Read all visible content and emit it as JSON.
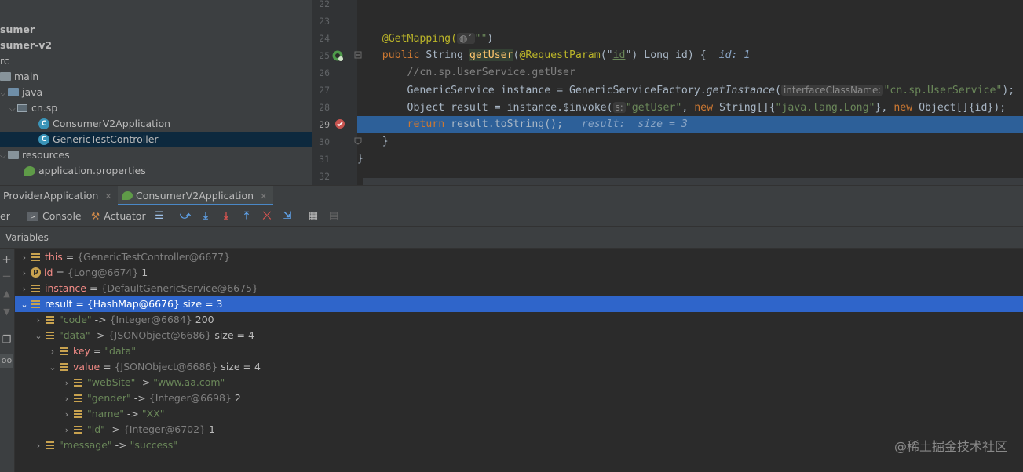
{
  "project_tree": [
    {
      "label": "sumer",
      "bold": true
    },
    {
      "label": "sumer-v2",
      "bold": true
    },
    {
      "label": "rc"
    },
    {
      "label": "main"
    },
    {
      "label": "java"
    },
    {
      "label": "cn.sp"
    },
    {
      "label": "ConsumerV2Application"
    },
    {
      "label": "GenericTestController"
    },
    {
      "label": "resources"
    },
    {
      "label": "application.properties"
    }
  ],
  "editor": {
    "line_numbers": [
      "22",
      "23",
      "24",
      "25",
      "26",
      "27",
      "28",
      "29",
      "30",
      "31",
      "32"
    ],
    "line24": {
      "annotation": "@GetMapping(",
      "icon_text": "◍˅",
      "str": "\"\"",
      "close": ")"
    },
    "line25": {
      "kw_public": "public",
      "type": " String ",
      "fn": "getUser",
      "open": "(",
      "ann": "@RequestParam",
      "p1": "(\"",
      "id": "id",
      "p2": "\") Long id) {",
      "hint": "id: 1"
    },
    "line26": {
      "comment": "//cn.sp.UserService.getUser"
    },
    "line27": {
      "pre": "GenericService instance = GenericServiceFactory.",
      "method": "getInstance",
      "open": "(",
      "hint": "interfaceClassName:",
      "str": "\"cn.sp.UserService\"",
      "close": ");"
    },
    "line28": {
      "pre": "Object result = instance.$invoke(",
      "hint": "s:",
      "str1": "\"getUser\"",
      "c1": ", ",
      "kw1": "new",
      "t1": " String[]{",
      "str2": "\"java.lang.Long\"",
      "c2": "}, ",
      "kw2": "new",
      "t2": " Object[]{id});"
    },
    "line29": {
      "kw": "return",
      "code": " result.toString();",
      "dbg": "result:  size = 3"
    },
    "line30": {
      "code": "}"
    },
    "line31": {
      "code": "}"
    }
  },
  "run_tabs": [
    {
      "label": "ProviderApplication",
      "active": false
    },
    {
      "label": "ConsumerV2Application",
      "active": true
    }
  ],
  "toolbar": {
    "debugger_label": "er",
    "console_label": "Console",
    "actuator_label": "Actuator"
  },
  "variables_header": "Variables",
  "variables": [
    {
      "name": "this",
      "eq": " = ",
      "value": "{GenericTestController@6677}"
    },
    {
      "name": "id",
      "eq": " = ",
      "value": "{Long@6674}",
      "extra": " 1"
    },
    {
      "name": "instance",
      "eq": " = ",
      "value": "{DefaultGenericService@6675}"
    },
    {
      "name": "result",
      "eq": " = ",
      "value": "{HashMap@6676}",
      "extra": "  size = 3"
    },
    {
      "key": "\"code\"",
      "arrow": " -> ",
      "value": "{Integer@6684}",
      "extra": " 200"
    },
    {
      "key": "\"data\"",
      "arrow": " -> ",
      "value": "{JSONObject@6686}",
      "extra": "  size = 4"
    },
    {
      "name": "key",
      "eq": " = ",
      "str": "\"data\""
    },
    {
      "name": "value",
      "eq": " = ",
      "value": "{JSONObject@6686}",
      "extra": "  size = 4"
    },
    {
      "key": "\"webSite\"",
      "arrow": " -> ",
      "str": "\"www.aa.com\""
    },
    {
      "key": "\"gender\"",
      "arrow": " -> ",
      "value": "{Integer@6698}",
      "extra": " 2"
    },
    {
      "key": "\"name\"",
      "arrow": " -> ",
      "str": "\"XX\""
    },
    {
      "key": "\"id\"",
      "arrow": " -> ",
      "value": "{Integer@6702}",
      "extra": " 1"
    },
    {
      "key": "\"message\"",
      "arrow": " -> ",
      "str": "\"success\""
    }
  ],
  "watermark": "@稀土掘金技术社区",
  "colors": {
    "accent": "#2f65ca",
    "current_line": "#2d6099",
    "keyword": "#cc7832",
    "string": "#6a8759",
    "annotation": "#bbb529"
  }
}
